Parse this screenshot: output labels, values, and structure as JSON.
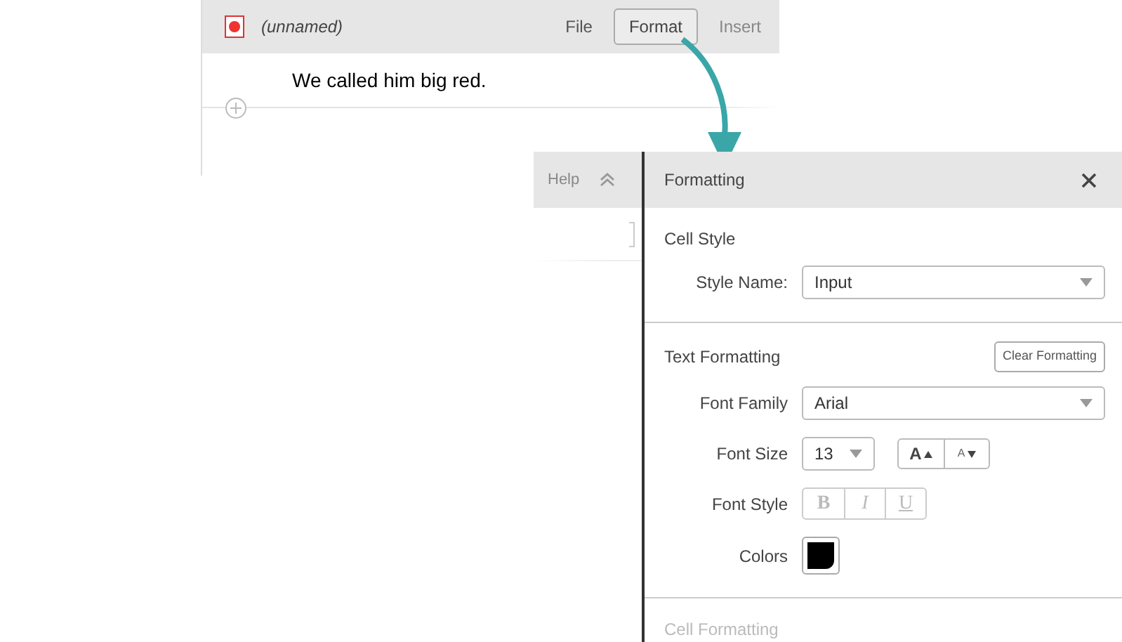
{
  "notebook": {
    "title": "(unnamed)",
    "menu": [
      {
        "label": "File",
        "selected": false
      },
      {
        "label": "Format",
        "selected": true
      },
      {
        "label": "Insert",
        "selected": false
      }
    ],
    "cell_text": "We called him big red."
  },
  "back_window": {
    "menu_item": "Help"
  },
  "formatting_panel": {
    "title": "Formatting",
    "cell_style": {
      "heading": "Cell Style",
      "style_name_label": "Style Name:",
      "style_name_value": "Input"
    },
    "text_formatting": {
      "heading": "Text Formatting",
      "clear_button": "Clear Formatting",
      "font_family_label": "Font Family",
      "font_family_value": "Arial",
      "font_size_label": "Font Size",
      "font_size_value": "13",
      "size_buttons": [
        "A",
        "A"
      ],
      "font_style_label": "Font Style",
      "font_style_buttons": [
        {
          "label": "B",
          "disabled": true
        },
        {
          "label": "I",
          "disabled": true
        },
        {
          "label": "U",
          "disabled": true
        }
      ],
      "colors_label": "Colors"
    },
    "cell_formatting": {
      "heading": "Cell Formatting"
    }
  }
}
